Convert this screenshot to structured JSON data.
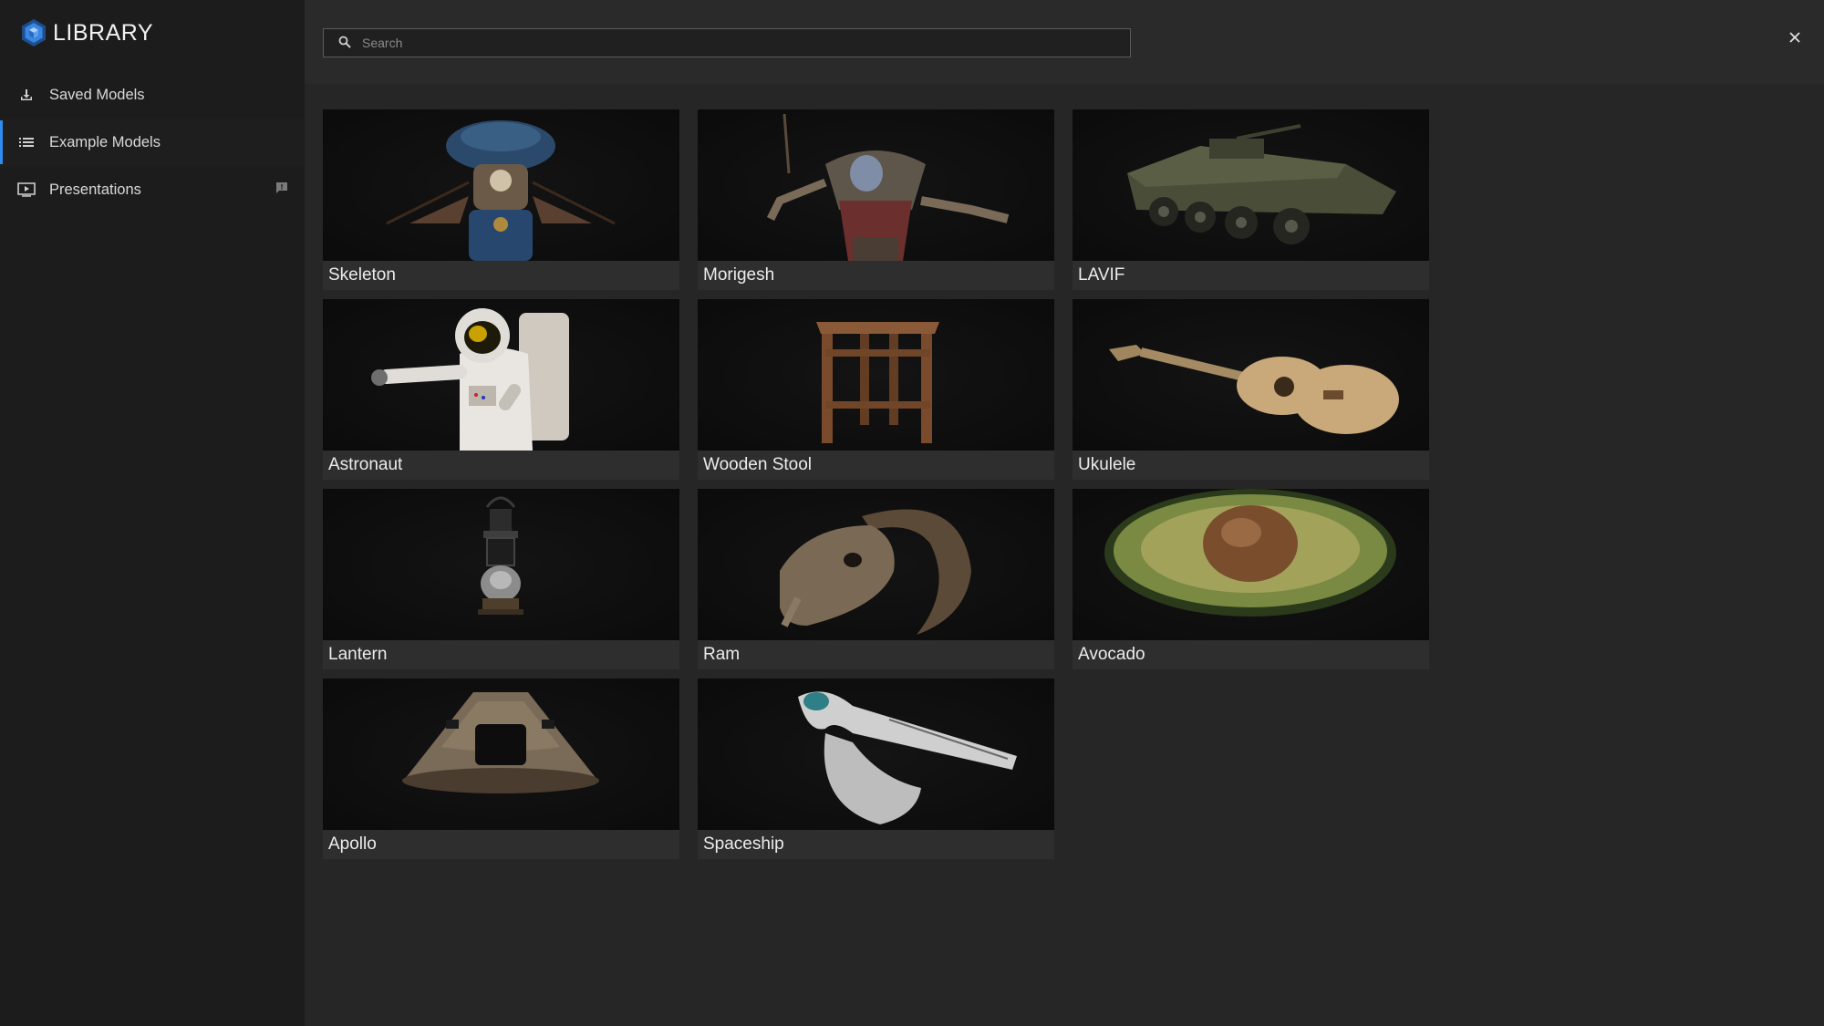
{
  "sidebar": {
    "brand": {
      "title": "LIBRARY",
      "icon": "hexagon-cube-logo",
      "accent": "#2d8cf0"
    },
    "items": [
      {
        "label": "Saved Models",
        "icon": "download-icon"
      },
      {
        "label": "Example Models",
        "icon": "list-icon",
        "active": true
      },
      {
        "label": "Presentations",
        "icon": "presentation-icon",
        "badge_icon": "comment-icon"
      }
    ]
  },
  "search": {
    "placeholder": "Search",
    "value": ""
  },
  "models": [
    {
      "name": "Skeleton"
    },
    {
      "name": "Morigesh"
    },
    {
      "name": "LAVIF"
    },
    {
      "name": "Astronaut"
    },
    {
      "name": "Wooden Stool"
    },
    {
      "name": "Ukulele"
    },
    {
      "name": "Lantern"
    },
    {
      "name": "Ram"
    },
    {
      "name": "Avocado"
    },
    {
      "name": "Apollo"
    },
    {
      "name": "Spaceship"
    }
  ]
}
